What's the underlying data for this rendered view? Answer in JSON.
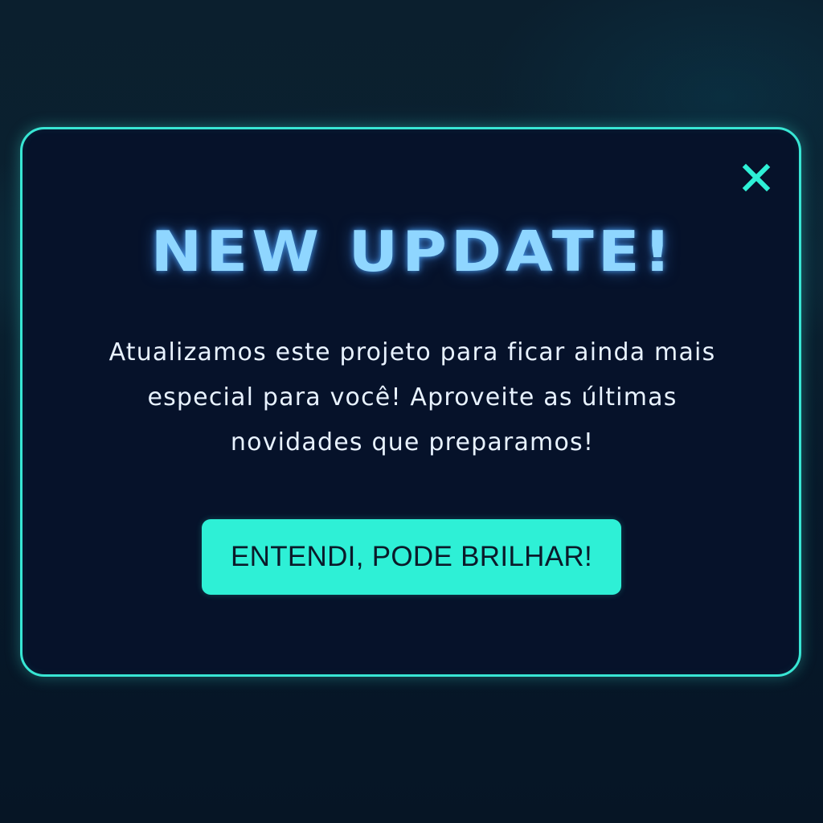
{
  "dialog": {
    "title": "NEW UPDATE!",
    "message": "Atualizamos este projeto para ficar ainda mais especial para você! Aproveite as últimas novidades que preparamos!",
    "close_icon": "close-icon",
    "cta_label": "ENTENDI, PODE BRILHAR!"
  },
  "colors": {
    "accent": "#2ef0d6",
    "border": "#38e6d4",
    "title": "#8fd6ff",
    "panel": "#06122a",
    "text": "#e8f2ff",
    "button_text": "#0b1a2a"
  }
}
